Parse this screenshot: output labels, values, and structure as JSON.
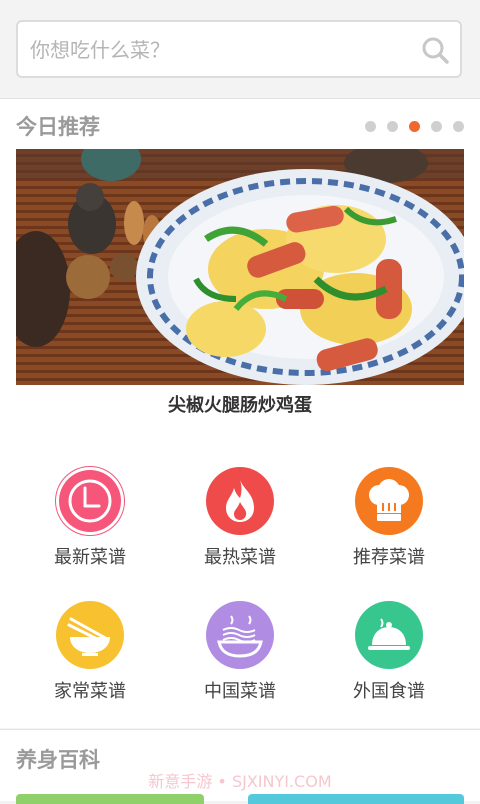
{
  "search": {
    "placeholder": "你想吃什么菜？"
  },
  "recommend": {
    "title": "今日推荐",
    "carousel": {
      "count": 5,
      "active_index": 2
    },
    "banner_caption": "尖椒火腿肠炒鸡蛋"
  },
  "categories": [
    {
      "label": "最新菜谱",
      "icon": "clock-icon",
      "color": "#f5567a"
    },
    {
      "label": "最热菜谱",
      "icon": "flame-icon",
      "color": "#ef4b4b"
    },
    {
      "label": "推荐菜谱",
      "icon": "chef-hat-icon",
      "color": "#f57a1f"
    },
    {
      "label": "家常菜谱",
      "icon": "bowl-chopsticks-icon",
      "color": "#f7c12f"
    },
    {
      "label": "中国菜谱",
      "icon": "noodles-icon",
      "color": "#b18ce3"
    },
    {
      "label": "外国食谱",
      "icon": "cloche-icon",
      "color": "#37c68e"
    }
  ],
  "health": {
    "title": "养身百科"
  },
  "watermark": "新意手游 • SJXINYI.COM"
}
